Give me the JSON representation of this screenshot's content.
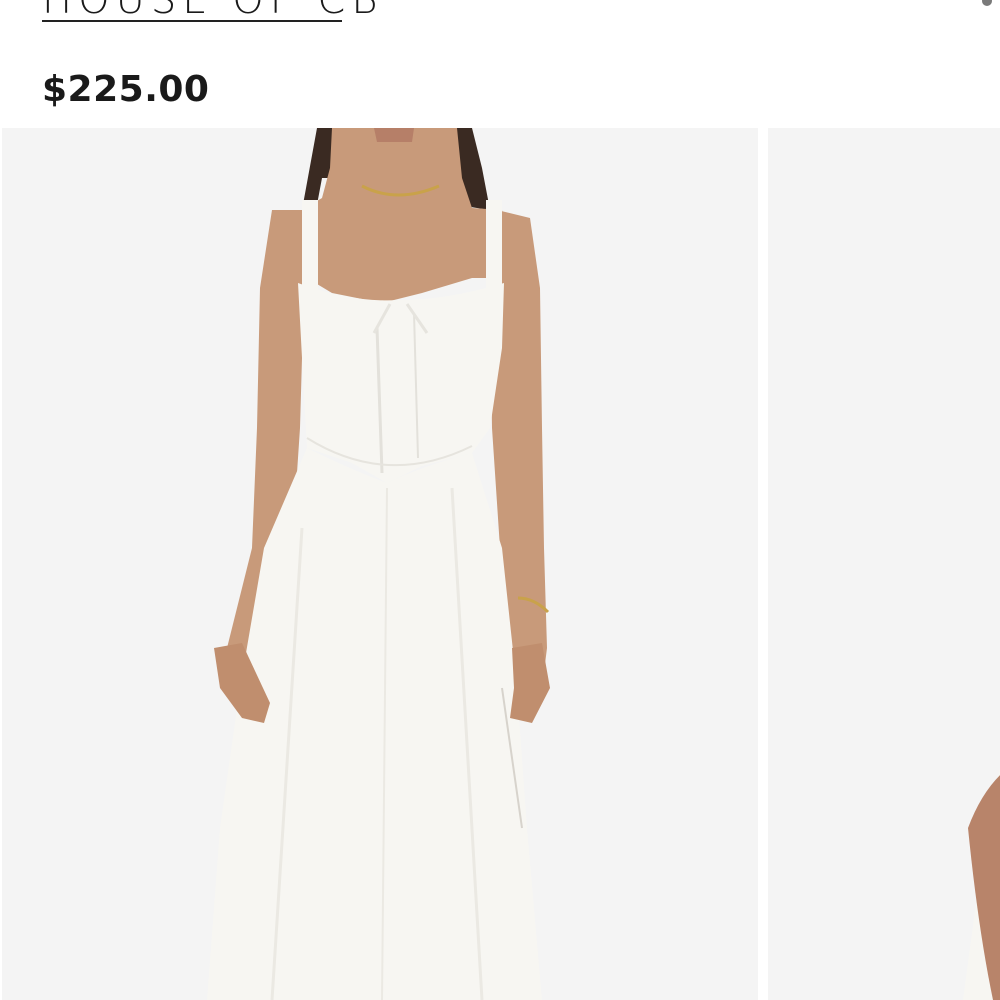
{
  "header": {
    "brand": "HOUSE OF CB"
  },
  "product": {
    "price": "$225.00"
  },
  "gallery": {
    "main_image": "photo-model-white-corset-midi-dress-front",
    "next_image": "photo-model-white-dress-partial"
  },
  "icons": {
    "more": "more-dots-icon"
  },
  "colors": {
    "text": "#1a1a1a",
    "photo_background": "#f4f4f4",
    "dress": "#f7f6f2",
    "skin": "#c89a7a",
    "hair": "#3a2a22"
  }
}
